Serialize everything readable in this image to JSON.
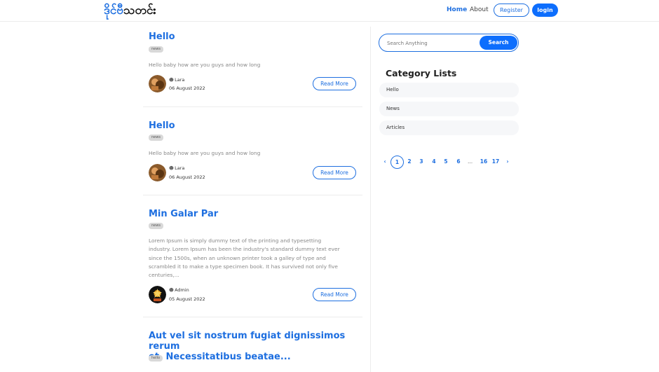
{
  "header": {
    "logo_part1": "ဒိုင်ဗီ",
    "logo_part2": "သတင်း",
    "nav_home": "Home",
    "nav_about": "About",
    "register_label": "Register",
    "login_label": "login"
  },
  "posts": [
    {
      "title": "Hello",
      "tag": "news",
      "excerpt": "Hello baby how are you guys and how long",
      "author": "Lara",
      "date": "06 August 2022",
      "read_more": "Read More"
    },
    {
      "title": "Hello",
      "tag": "news",
      "excerpt": "Hello baby how are you guys and how long",
      "author": "Lara",
      "date": "06 August 2022",
      "read_more": "Read More"
    },
    {
      "title": "Min Galar Par",
      "tag": "news",
      "excerpt_lines": [
        "Lorem Ipsum is simply dummy text of the printing and typesetting",
        "industry. Lorem Ipsum has been the industry's standard dummy text ever",
        "since the 1500s, when an unknown printer took a galley of type and",
        "scrambled it to make a type specimen book. It has survived not only five",
        "centuries,..."
      ],
      "author": "Admin",
      "date": "05 August 2022",
      "read_more": "Read More"
    },
    {
      "title_lines": [
        "Aut vel sit nostrum fugiat dignissimos rerum",
        "et. Necessitatibus beatae..."
      ],
      "tag": "hello"
    }
  ],
  "sidebar": {
    "search_placeholder": "Search Anything",
    "search_button": "Search",
    "category_heading": "Category Lists",
    "categories": [
      "Hello",
      "News",
      "Articles"
    ]
  },
  "pagination": {
    "prev": "‹",
    "pages": [
      "1",
      "2",
      "3",
      "4",
      "5",
      "6"
    ],
    "ellipsis": "...",
    "last_pages": [
      "16",
      "17"
    ],
    "next": "›",
    "current": "1"
  },
  "colors": {
    "accent": "#1e6fe0",
    "button_primary": "#0d6efd",
    "tag_bg": "#d9d9d9",
    "category_bg": "#f6f7f9"
  }
}
